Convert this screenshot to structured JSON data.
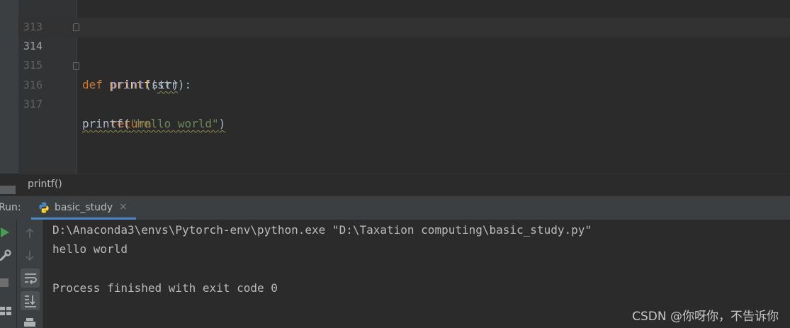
{
  "editor": {
    "lines": [
      {
        "number": "313"
      },
      {
        "number": "314",
        "tokens": [
          "def",
          "printf",
          "(",
          "str",
          "):"
        ]
      },
      {
        "number": "315",
        "tokens": [
          "print",
          "(str)"
        ]
      },
      {
        "number": "316",
        "tokens": [
          "return"
        ]
      },
      {
        "number": "317",
        "tokens": [
          "printf(",
          "\"hello world\"",
          ")"
        ]
      }
    ]
  },
  "breadcrumb": {
    "text": "printf()"
  },
  "run": {
    "label": "Run:",
    "tab_name": "basic_study",
    "tab_close": "×"
  },
  "console": {
    "lines": [
      "D:\\Anaconda3\\envs\\Pytorch-env\\python.exe \"D:\\Taxation computing\\basic_study.py\"",
      "hello world",
      "",
      "Process finished with exit code 0"
    ]
  },
  "watermark": "CSDN @你呀你，不告诉你",
  "colors": {
    "keyword": "#cc7832",
    "function": "#ffc66d",
    "builtin": "#8888c6",
    "string": "#6a8759",
    "run_green": "#499c54",
    "tab_underline": "#4a88c7"
  },
  "icons": [
    "run-icon",
    "wrench-icon",
    "stop-icon",
    "layout-icon",
    "up-arrow-icon",
    "down-arrow-icon",
    "soft-wrap-icon",
    "scroll-to-end-icon",
    "print-icon",
    "python-file-icon",
    "fold-icon"
  ]
}
